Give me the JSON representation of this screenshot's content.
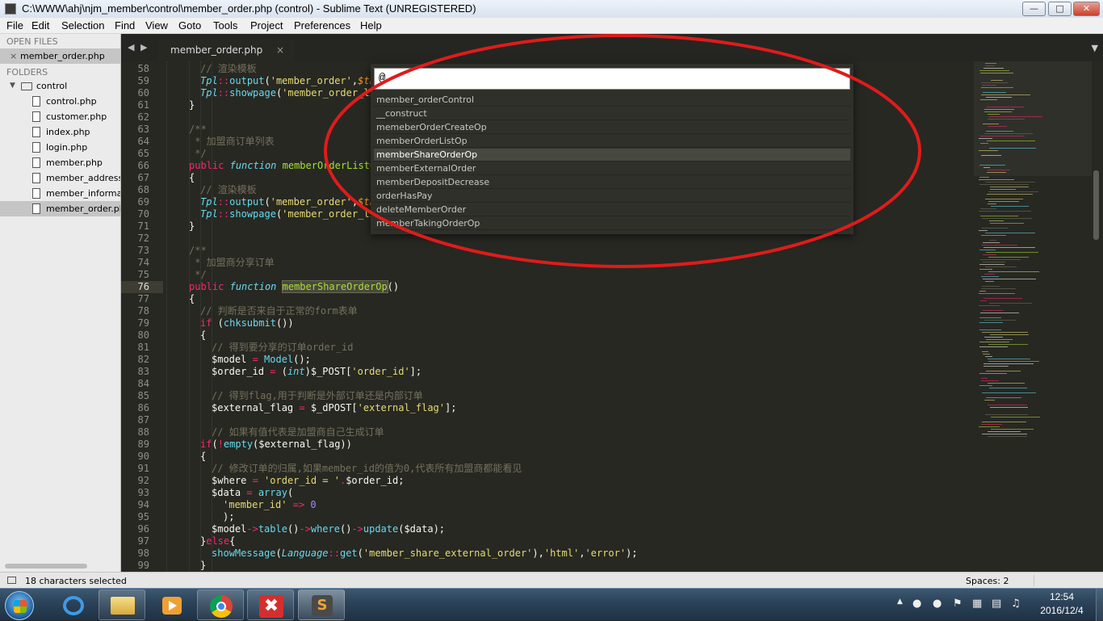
{
  "window": {
    "title": "C:\\WWW\\ahj\\njm_member\\control\\member_order.php (control) - Sublime Text (UNREGISTERED)"
  },
  "menu": [
    "File",
    "Edit",
    "Selection",
    "Find",
    "View",
    "Goto",
    "Tools",
    "Project",
    "Preferences",
    "Help"
  ],
  "sidebar": {
    "open_files_header": "OPEN FILES",
    "open_files": [
      "member_order.php"
    ],
    "folders_header": "FOLDERS",
    "folder": "control",
    "files": [
      "control.php",
      "customer.php",
      "index.php",
      "login.php",
      "member.php",
      "member_address.p",
      "member_informati",
      "member_order.ph"
    ],
    "selected_file": "member_order.ph"
  },
  "tabs": [
    {
      "label": "member_order.php",
      "close": "×",
      "active": true
    }
  ],
  "editor": {
    "current_line": 76,
    "line_numbers": [
      58,
      59,
      60,
      61,
      62,
      63,
      64,
      65,
      66,
      67,
      68,
      69,
      70,
      71,
      72,
      73,
      74,
      75,
      76,
      77,
      78,
      79,
      80,
      81,
      82,
      83,
      84,
      85,
      86,
      87,
      88,
      89,
      90,
      91,
      92,
      93,
      94,
      95,
      96,
      97,
      98,
      99
    ]
  },
  "palette": {
    "query": "@",
    "items": [
      "member_orderControl",
      "__construct",
      "memeberOrderCreateOp",
      "memberOrderListOp",
      "memberShareOrderOp",
      "memberExternalOrder",
      "memberDepositDecrease",
      "orderHasPay",
      "deleteMemberOrder",
      "memberTakingOrderOp"
    ],
    "selected": "memberShareOrderOp"
  },
  "annotation": {
    "ellipse_color": "#e01b1b"
  },
  "statusbar": {
    "selection": "18 characters selected",
    "indent": "Spaces: 2"
  },
  "taskbar": {
    "apps": [
      "ie-icon",
      "explorer-icon",
      "media-player-icon",
      "chrome-icon",
      "xmind-icon",
      "sublime-text-icon"
    ],
    "time": "12:54",
    "date": "2016/12/4"
  },
  "colors": {
    "editor_bg": "#272822",
    "comment": "#75715e",
    "keyword": "#f92672",
    "function": "#a6e22e",
    "string": "#e6db74",
    "storage": "#66d9ef"
  }
}
